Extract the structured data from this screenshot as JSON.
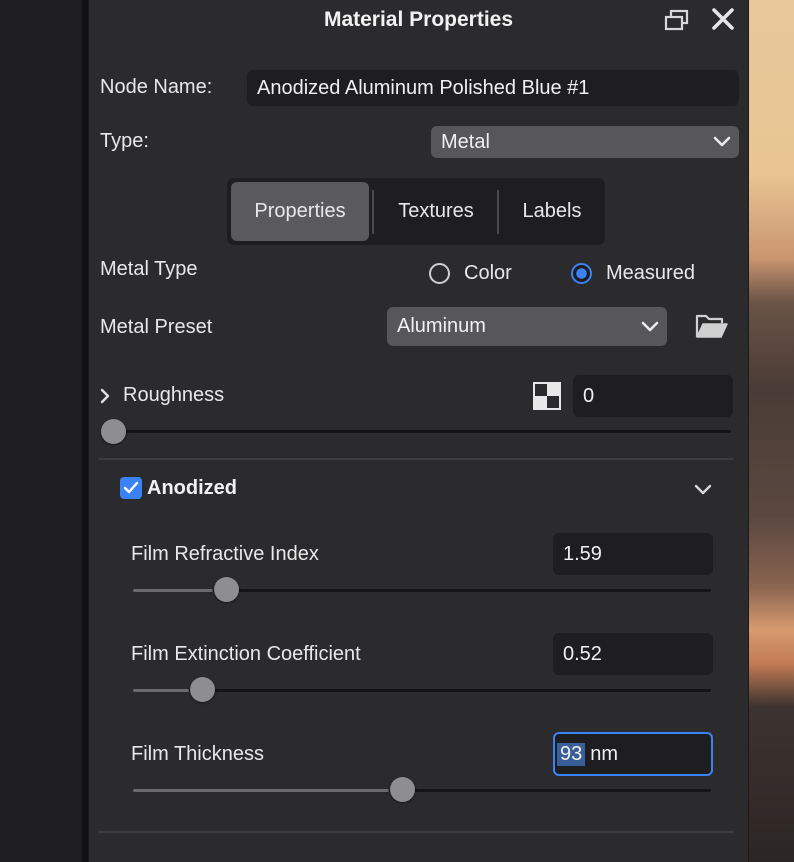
{
  "panel": {
    "title": "Material Properties",
    "window_controls": {
      "restore_icon": "restore-window-icon",
      "close_icon": "close-icon"
    }
  },
  "node_name": {
    "label": "Node Name:",
    "value": "Anodized Aluminum Polished Blue #1"
  },
  "type": {
    "label": "Type:",
    "value": "Metal"
  },
  "tabs": [
    {
      "label": "Properties",
      "active": true
    },
    {
      "label": "Textures",
      "active": false
    },
    {
      "label": "Labels",
      "active": false
    }
  ],
  "metal_type": {
    "label": "Metal Type",
    "options": [
      {
        "label": "Color",
        "selected": false
      },
      {
        "label": "Measured",
        "selected": true
      }
    ]
  },
  "metal_preset": {
    "label": "Metal Preset",
    "value": "Aluminum",
    "folder_icon": "folder-open-icon"
  },
  "roughness": {
    "label": "Roughness",
    "value": "0",
    "slider_fraction": 0,
    "texture_icon": "checker-texture-icon"
  },
  "anodized": {
    "label": "Anodized",
    "checked": true,
    "expanded": true,
    "film_refractive_index": {
      "label": "Film Refractive Index",
      "value": "1.59",
      "slider_fraction": 0.164
    },
    "film_extinction_coefficient": {
      "label": "Film Extinction Coefficient",
      "value": "0.52",
      "slider_fraction": 0.122
    },
    "film_thickness": {
      "label": "Film Thickness",
      "value": "93",
      "unit": "nm",
      "slider_fraction": 0.465
    }
  },
  "colors": {
    "accent": "#3b82f6",
    "panel_bg": "#2b2b2d",
    "field_bg": "#1e1e20",
    "select_bg": "#57575a"
  }
}
